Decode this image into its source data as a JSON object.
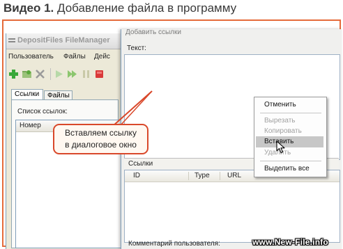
{
  "caption": {
    "prefix": "Видео 1.",
    "text": "Добавление файла в программу"
  },
  "main_window": {
    "title": "DepositFiles FileManager",
    "menu": [
      "Пользователь",
      "Файлы",
      "Дейс"
    ],
    "toolbar_icons": [
      "add-icon",
      "folder-icon",
      "delete-icon",
      "play-icon",
      "fast-forward-icon",
      "pause-icon",
      "stop-icon"
    ],
    "tabs": [
      "Ссылки",
      "Файлы"
    ],
    "list_label": "Список ссылок:",
    "list_columns": [
      "Номер"
    ]
  },
  "dialog": {
    "title": "Добавить ссылки",
    "text_label": "Текст:",
    "links_label": "Ссылки",
    "columns": [
      "ID",
      "Type",
      "URL"
    ],
    "comment_label": "Комментарий пользователя:"
  },
  "context_menu": {
    "items": [
      {
        "label": "Отменить",
        "enabled": true
      },
      {
        "label": "Вырезать",
        "enabled": false
      },
      {
        "label": "Копировать",
        "enabled": false
      },
      {
        "label": "Вставить",
        "enabled": true,
        "highlighted": true
      },
      {
        "label": "Удалить",
        "enabled": false
      },
      {
        "label": "Выделить все",
        "enabled": true
      }
    ]
  },
  "callout": {
    "line1": "Вставляем ссылку",
    "line2": "в диалоговое окно"
  },
  "watermark": "www.New-File.info",
  "colors": {
    "frame_border": "#e56a3a",
    "callout_border": "#d9482a",
    "menu_highlight": "#c7c7c7"
  }
}
